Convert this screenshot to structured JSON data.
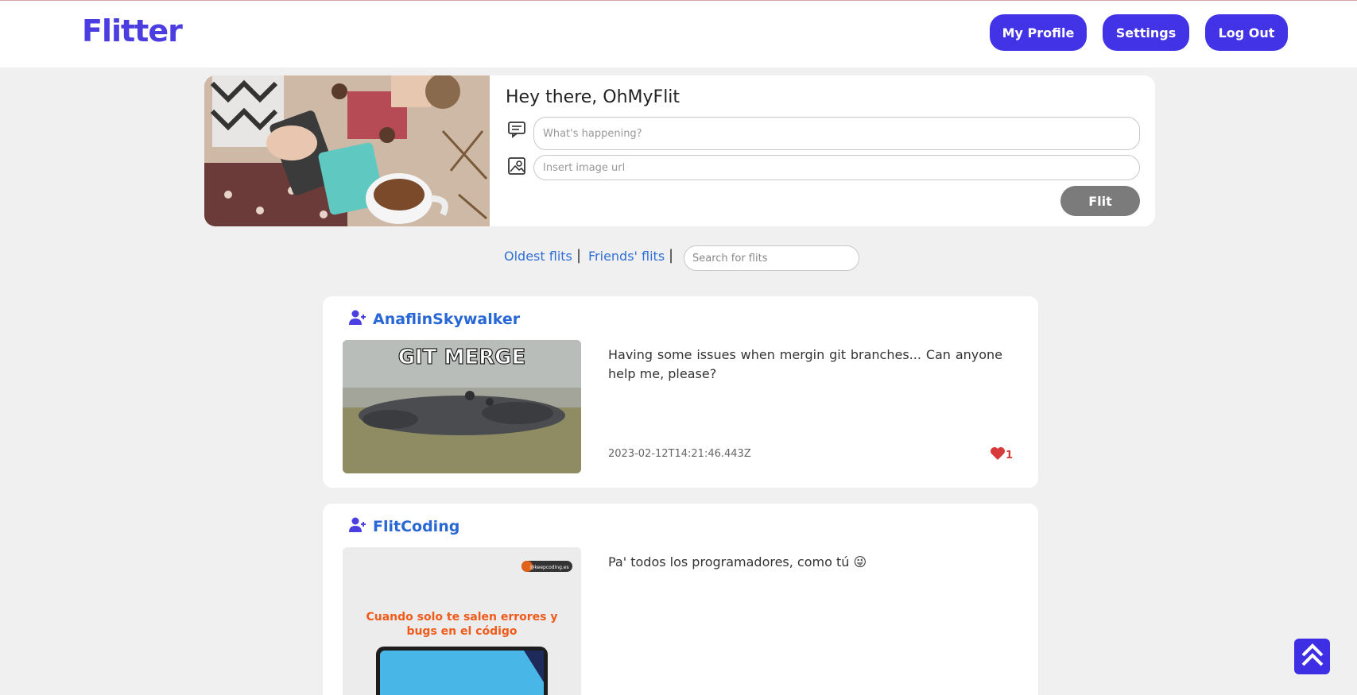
{
  "header": {
    "logo": "Flitter",
    "buttons": {
      "profile": "My Profile",
      "settings": "Settings",
      "logout": "Log Out"
    }
  },
  "composer": {
    "greeting": "Hey there, OhMyFlit",
    "text_placeholder": "What's happening?",
    "image_placeholder": "Insert image url",
    "submit_label": "Flit"
  },
  "filters": {
    "oldest": "Oldest flits",
    "friends": "Friends' flits",
    "separator": "|",
    "search_placeholder": "Search for flits"
  },
  "posts": [
    {
      "username": "AnaflinSkywalker",
      "image_caption": "GIT MERGE",
      "text": "Having some issues when mergin git branches... Can anyone help me, please?",
      "timestamp": "2023-02-12T14:21:46.443Z",
      "likes": "1"
    },
    {
      "username": "FlitCoding",
      "image_badge": "@keepcoding.es",
      "image_caption": "Cuando solo te salen errores y bugs en el código",
      "text": "Pa' todos los programadores, como tú 😜"
    }
  ],
  "colors": {
    "brand": "#4233e6",
    "link": "#2f6fd6",
    "like": "#d63a3a"
  }
}
